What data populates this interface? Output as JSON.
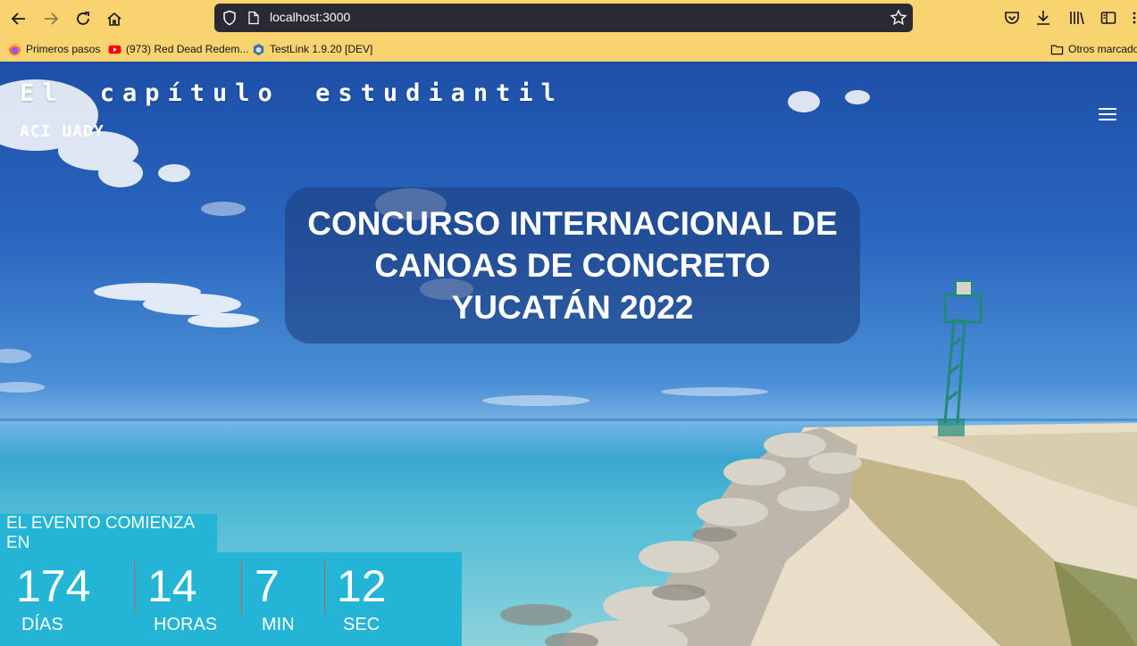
{
  "browser": {
    "url": "localhost:3000",
    "bookmarks": [
      {
        "label": "Primeros pasos",
        "icon": "firefox-icon"
      },
      {
        "label": "(973) Red Dead Redem...",
        "icon": "youtube-icon"
      },
      {
        "label": "TestLink 1.9.20 [DEV]",
        "icon": "testlink-icon"
      }
    ],
    "other_bookmarks": "Otros marcado"
  },
  "site": {
    "title": "El capítulo estudiantil",
    "subtitle": "ACI UADY"
  },
  "hero": {
    "title": "CONCURSO INTERNACIONAL DE CANOAS DE CONCRETO YUCATÁN 2022"
  },
  "countdown": {
    "label": "EL EVENTO COMIENZA EN",
    "items": [
      {
        "value": "174",
        "unit": "DÍAS"
      },
      {
        "value": "14",
        "unit": "HORAS"
      },
      {
        "value": "7",
        "unit": "MIN"
      },
      {
        "value": "12",
        "unit": "SEC"
      }
    ]
  },
  "colors": {
    "chrome": "#f9d36f",
    "countdown_bg": "#24b5d6",
    "hero_overlay": "#1c3a78"
  }
}
